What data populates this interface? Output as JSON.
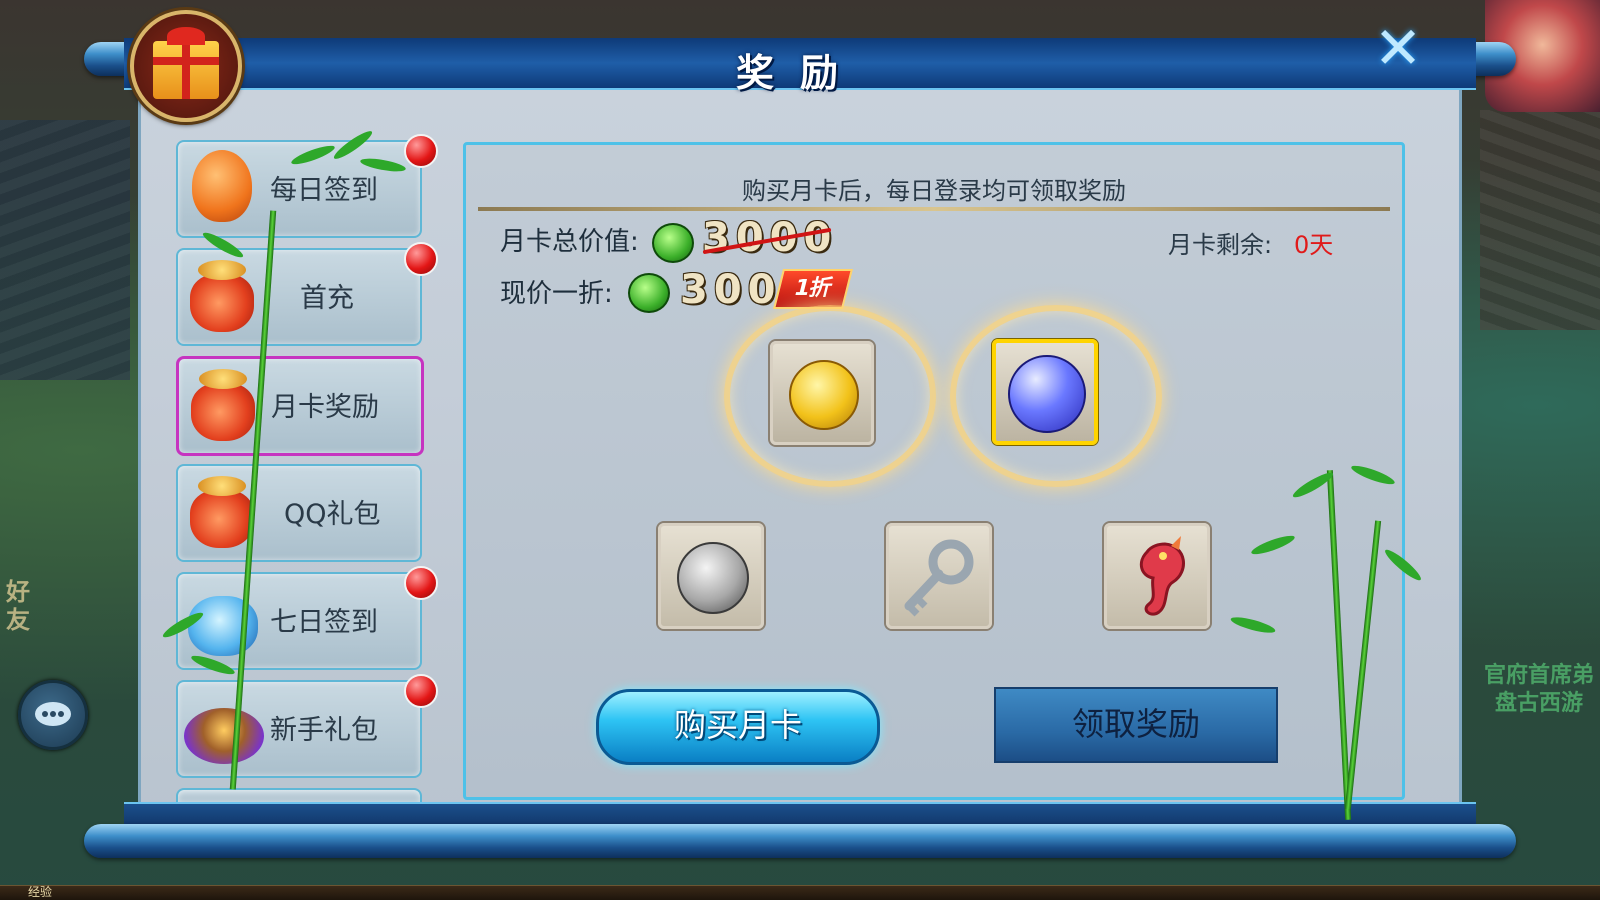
{
  "header": {
    "title": "奖励",
    "close_glyph": "✕"
  },
  "sidebar": {
    "items": [
      {
        "label": "每日签到",
        "icon": "orange-pouch-icon",
        "badge": true,
        "active": false
      },
      {
        "label": "首充",
        "icon": "red-lucky-bag-icon",
        "badge": true,
        "active": false
      },
      {
        "label": "月卡奖励",
        "icon": "red-lucky-bag-icon",
        "badge": false,
        "active": true
      },
      {
        "label": "QQ礼包",
        "icon": "red-lucky-bag-icon",
        "badge": false,
        "active": false
      },
      {
        "label": "七日签到",
        "icon": "blue-lucky-bag-icon",
        "badge": true,
        "active": false
      },
      {
        "label": "新手礼包",
        "icon": "purple-flame-gift-icon",
        "badge": true,
        "active": false
      }
    ]
  },
  "main": {
    "description": "购买月卡后，每日登录均可领取奖励",
    "total_value_label": "月卡总价值:",
    "total_value": "3000",
    "current_price_label": "现价一折:",
    "current_price": "300",
    "discount_tag": "1折",
    "remaining_label": "月卡剩余:",
    "remaining_value": "0天",
    "featured_rewards": [
      {
        "icon": "gold-dream-coin-icon",
        "selected": false
      },
      {
        "icon": "blue-pearl-orb-icon",
        "selected": true
      }
    ],
    "extra_rewards": [
      {
        "icon": "silver-coin-icon"
      },
      {
        "icon": "silver-key-icon"
      },
      {
        "icon": "red-seahorse-icon"
      }
    ],
    "buy_button": "购买月卡",
    "claim_button": "领取奖励"
  },
  "hud": {
    "friend_label": "好友",
    "exp_label": "经验",
    "right_caption_1": "官府首席弟",
    "right_caption_2": "盘古西游"
  },
  "colors": {
    "accent_border": "#4ec1e8",
    "active_tab_border": "#c634c0",
    "remaining_text": "#e01a1a",
    "badge_red": "#e31616"
  }
}
